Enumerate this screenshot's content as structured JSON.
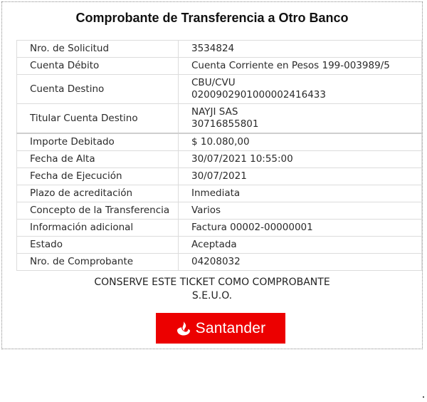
{
  "title": "Comprobante de Transferencia a Otro Banco",
  "details": [
    {
      "label": "Nro. de Solicitud",
      "value": "3534824",
      "value2": ""
    },
    {
      "label": "Cuenta Débito",
      "value": "Cuenta Corriente en Pesos 199-003989/5",
      "value2": ""
    },
    {
      "label": "Cuenta Destino",
      "value": "CBU/CVU",
      "value2": "0200902901000002416433"
    },
    {
      "label": "Titular Cuenta Destino",
      "value": "NAYJI SAS",
      "value2": "30716855801"
    },
    {
      "label": "Importe Debitado",
      "value": "$ 10.080,00",
      "value2": ""
    },
    {
      "label": "Fecha de Alta",
      "value": "30/07/2021 10:55:00",
      "value2": ""
    },
    {
      "label": "Fecha de Ejecución",
      "value": "30/07/2021",
      "value2": ""
    },
    {
      "label": "Plazo de acreditación",
      "value": "Inmediata",
      "value2": ""
    },
    {
      "label": "Concepto de la Transferencia",
      "value": "Varios",
      "value2": ""
    },
    {
      "label": "Información adicional",
      "value": "Factura 00002-00000001",
      "value2": ""
    },
    {
      "label": "Estado",
      "value": "Aceptada",
      "value2": ""
    },
    {
      "label": "Nro. de Comprobante",
      "value": "04208032",
      "value2": ""
    }
  ],
  "footer": {
    "line1": "CONSERVE ESTE TICKET COMO COMPROBANTE",
    "line2": "S.E.U.O."
  },
  "logo": {
    "text": "Santander",
    "icon": "santander-flame-icon",
    "background": "#ec0000",
    "foreground": "#ffffff"
  }
}
